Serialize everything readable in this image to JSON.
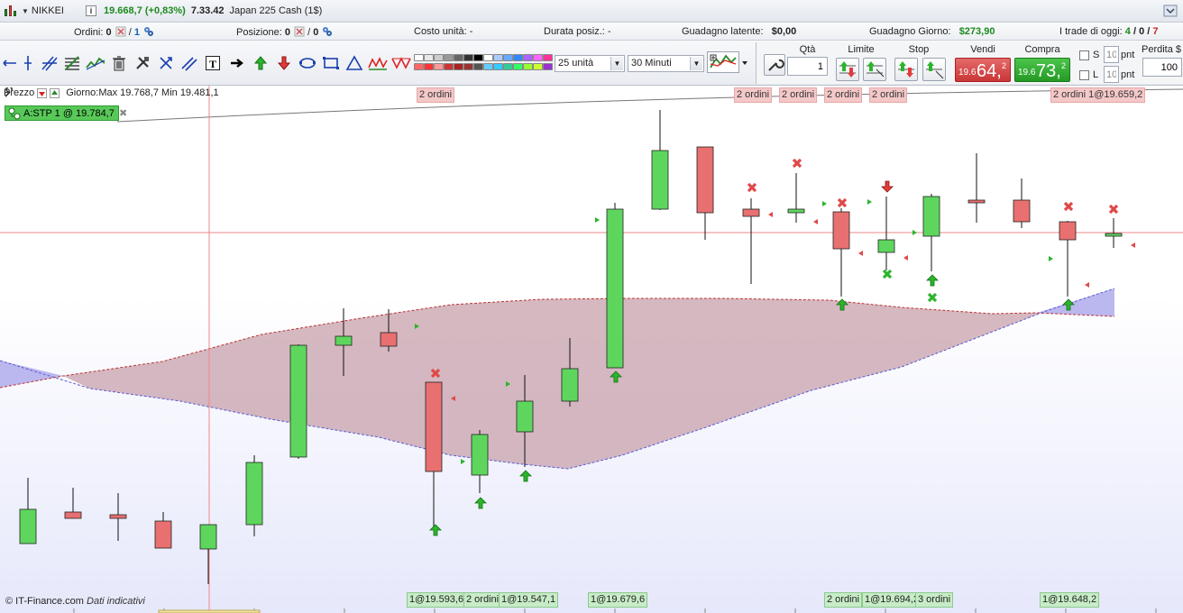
{
  "title": {
    "symbol": "NIKKEI",
    "info": "i",
    "price": "19.668,7 (+0,83%)",
    "time": "7.33.42",
    "instrument": "Japan 225 Cash (1$)"
  },
  "status": {
    "orders_label": "Ordini:",
    "orders_pending": "0",
    "orders_sep": "/",
    "orders_total": "1",
    "position_label": "Posizione:",
    "position_value": "0",
    "position_sep": "/",
    "position_total": "0",
    "unit_cost_label": "Costo unità:",
    "unit_cost_value": "-",
    "duration_label": "Durata posiz.:",
    "duration_value": "-",
    "latent_label": "Guadagno latente:",
    "latent_value": "$0,00",
    "day_gain_label": "Guadagno Giorno:",
    "day_gain_value": "$273,90",
    "trades_label": "I trade di oggi:",
    "trades_won": "4",
    "trades_sep1": "/",
    "trades_flat": "0",
    "trades_sep2": "/",
    "trades_lost": "7"
  },
  "toolbar": {
    "units_select": "25 unità",
    "timeframe_select": "30 Minuti",
    "text_tool": "T",
    "palette": [
      "#ffffff",
      "#e8e8e8",
      "#cccccc",
      "#999999",
      "#666666",
      "#333333",
      "#000000",
      "#ffffff",
      "#aaccff",
      "#66aaff",
      "#3388ff",
      "#aa66ff",
      "#ff66ff",
      "#ff3399",
      "#ff6666",
      "#ff3333",
      "#ff9999",
      "#cc3333",
      "#aa2222",
      "#993333",
      "#555555",
      "#66ccff",
      "#33ccff",
      "#33cc99",
      "#33ff66",
      "#99ff33",
      "#ccff33",
      "#9933cc"
    ]
  },
  "order_panel": {
    "qty_label": "Qtà",
    "qty_value": "1",
    "limit_label": "Limite",
    "stop_label": "Stop",
    "sell_label": "Vendi",
    "sell_small": "19.6",
    "sell_big": "64,",
    "sell_sup": "2",
    "buy_label": "Compra",
    "buy_small": "19.6",
    "buy_big": "73,",
    "buy_sup": "2",
    "s_label": "S",
    "s_value": "10",
    "s_unit": "pnt",
    "l_label": "L",
    "l_value": "10",
    "l_unit": "pnt",
    "loss_label": "Perdita $",
    "loss_value": "100"
  },
  "chart": {
    "price_label": "Prezzo",
    "day_info": "Giorno:Max 19.768,7 Min 19.481,1",
    "stp_tag": "A:STP  1 @ 19.784,7",
    "stp_close": "✖",
    "copyright": "© IT-Finance.com",
    "disclaimer": "Dati indicativi",
    "top_labels": [
      "2 ordini",
      "2 ordini",
      "2 ordini",
      "2 ordini",
      "2 ordini",
      "2 ordini 1@19.659,2"
    ],
    "bottom_labels": [
      "1@19.593,6",
      "2 ordini",
      "1@19.547,1",
      "1@19.679,6",
      "2 ordini",
      "1@19.694,2",
      "3 ordini",
      "1@19.648,2"
    ],
    "colors": {
      "bull": "#5ed65e",
      "bear": "#e87070",
      "cloud": "#c9a4ae",
      "cloud_blue": "#b8b8f4"
    }
  }
}
